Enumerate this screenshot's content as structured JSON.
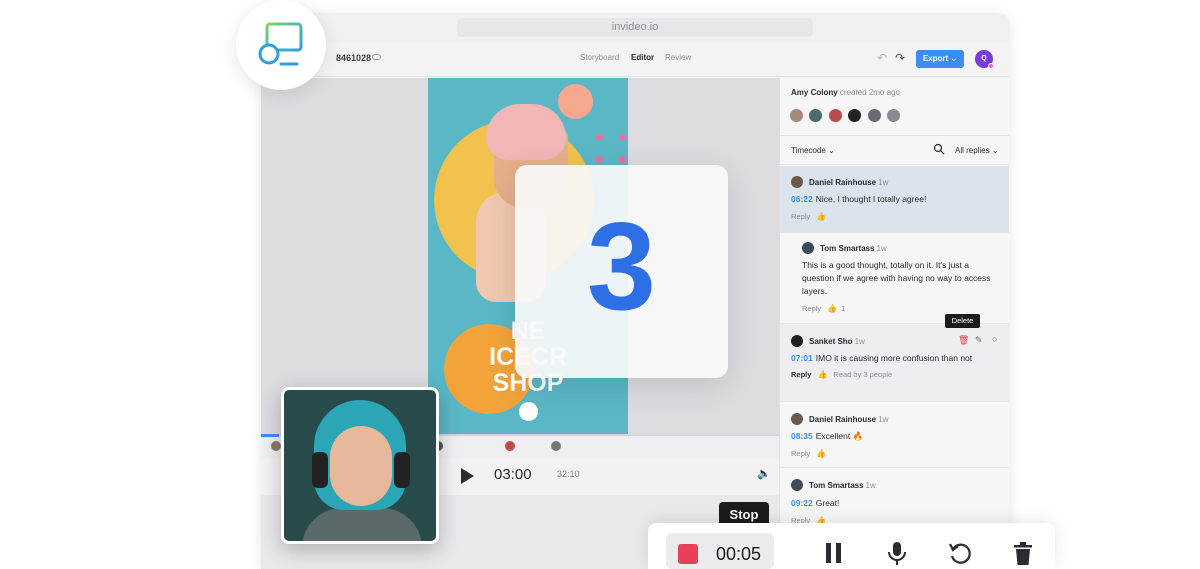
{
  "browser": {
    "url": "invideo.io"
  },
  "header": {
    "project_id": "8461028",
    "tabs": [
      {
        "label": "Storyboard",
        "active": false
      },
      {
        "label": "Editor",
        "active": true
      },
      {
        "label": "Review",
        "active": false
      }
    ],
    "export_label": "Export ⌄",
    "user_initial": "Q"
  },
  "poster": {
    "title_line1": "NE",
    "title_line2": "ICECR",
    "title_line3": "SHOP"
  },
  "player": {
    "current_time": "03:00",
    "duration": "32:10"
  },
  "comments": {
    "creator": {
      "name": "Amy Colony",
      "suffix": "created 2mo ago"
    },
    "filter_left": "Timecode ⌄",
    "filter_right": "All replies ⌄",
    "items": [
      {
        "author": "Daniel Rainhouse",
        "ago": "1w",
        "timecode": "06:22",
        "text": "Nice, I thought I totally agree!",
        "reply": "Reply",
        "highlight": true
      },
      {
        "author": "Tom Smartass",
        "ago": "1w",
        "text": "This is a good thought, totally on it. It's just a question if we agree with having no way to access layers.",
        "reply": "Reply",
        "likes": "1"
      },
      {
        "author": "Sanket Sho",
        "ago": "1w",
        "timecode": "07:01",
        "text": "IMO it is causing more confusion than not",
        "reply": "Reply",
        "read_by": "Read by 3 people"
      },
      {
        "author": "Daniel Rainhouse",
        "ago": "1w",
        "timecode": "08:35",
        "text": "Excellent 🔥",
        "reply": "Reply"
      },
      {
        "author": "Tom Smartass",
        "ago": "1w",
        "timecode": "09:22",
        "text": "Great!",
        "reply": "Reply"
      }
    ],
    "delete_tooltip": "Delete"
  },
  "countdown": {
    "value": "3"
  },
  "recorder": {
    "stop_tooltip": "Stop",
    "elapsed": "00:05"
  },
  "colors": {
    "accent": "#3d8ef0",
    "record": "#e8405a",
    "countdown": "#2f6fe6"
  },
  "icons": [
    "screen-record-logo-icon",
    "play-icon",
    "volume-icon",
    "search-icon",
    "pause-icon",
    "microphone-icon",
    "restart-icon",
    "trash-icon",
    "thumb-up-icon",
    "edit-icon",
    "undo-icon",
    "redo-icon"
  ]
}
